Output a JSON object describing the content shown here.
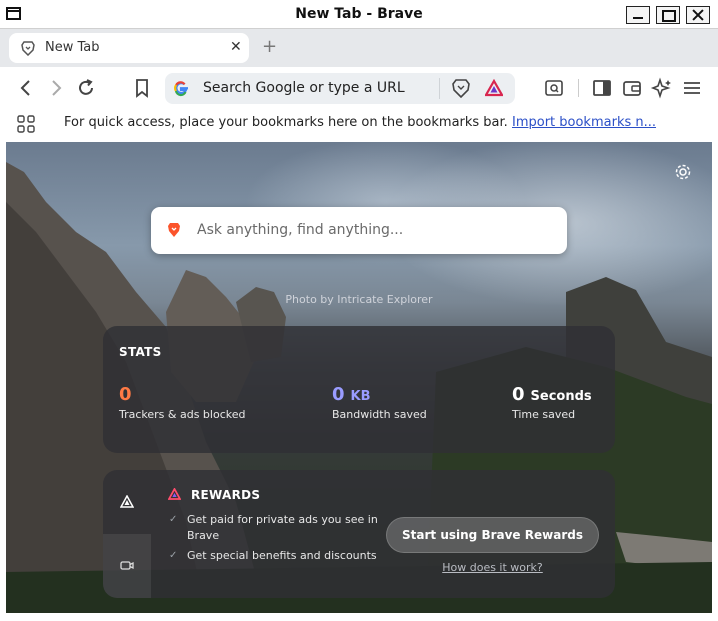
{
  "window": {
    "title": "New Tab - Brave"
  },
  "tabs": [
    {
      "label": "New Tab"
    }
  ],
  "toolbar": {
    "omnibox_placeholder": "Search Google or type a URL"
  },
  "bookmarks_bar": {
    "message": "For quick access, place your bookmarks here on the bookmarks bar.",
    "import_link": "Import bookmarks n..."
  },
  "ntp": {
    "search_placeholder": "Ask anything, find anything...",
    "photo_credit": "Photo by Intricate Explorer",
    "stats": {
      "heading": "STATS",
      "trackers": {
        "value": "0",
        "caption": "Trackers & ads blocked"
      },
      "bandwidth": {
        "value": "0",
        "unit": "KB",
        "caption": "Bandwidth saved"
      },
      "time": {
        "value": "0",
        "unit": "Seconds",
        "caption": "Time saved"
      }
    },
    "rewards": {
      "heading": "REWARDS",
      "benefits": [
        "Get paid for private ads you see in Brave",
        "Get special benefits and discounts"
      ],
      "cta": "Start using Brave Rewards",
      "how_link": "How does it work?"
    }
  },
  "colors": {
    "brave_orange": "#fb542b",
    "trackers": "#ff7a45",
    "bandwidth": "#9a9cff",
    "link": "#2b4fc7"
  }
}
